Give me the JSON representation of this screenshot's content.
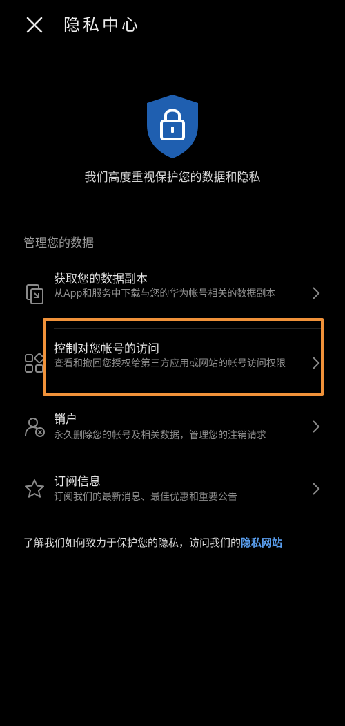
{
  "header": {
    "title": "隐私中心"
  },
  "tagline": "我们高度重视保护您的数据和隐私",
  "section": {
    "title": "管理您的数据"
  },
  "items": [
    {
      "title": "获取您的数据副本",
      "description": "从App和服务中下载与您的华为帐号相关的数据副本",
      "icon": "copy-icon"
    },
    {
      "title": "控制对您帐号的访问",
      "description": "查看和撤回您授权给第三方应用或网站的帐号访问权限",
      "icon": "apps-grid-icon"
    },
    {
      "title": "销户",
      "description": "永久删除您的帐号及相关数据，管理您的注销请求",
      "icon": "user-remove-icon"
    },
    {
      "title": "订阅信息",
      "description": "订阅我们的最新消息、最佳优惠和重要公告",
      "icon": "star-icon"
    }
  ],
  "footer": {
    "text": "了解我们如何致力于保护您的隐私，访问我们的",
    "link_label": "隐私网站"
  },
  "colors": {
    "background": "#000000",
    "shield": "#1f5fb0",
    "link": "#5a9ff0",
    "highlight": "#f0923a"
  }
}
